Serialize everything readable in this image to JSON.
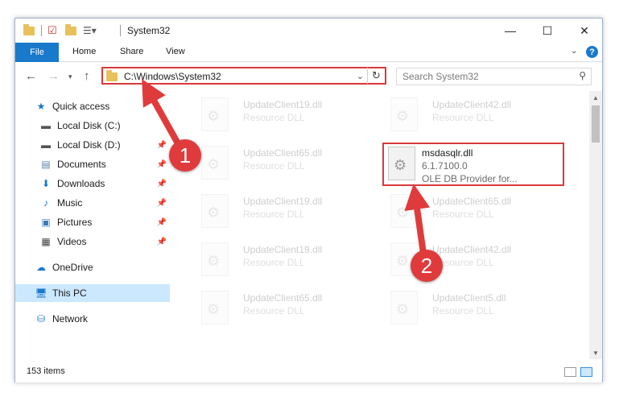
{
  "window": {
    "title": "System32",
    "controls": {
      "minimize": "—",
      "maximize": "☐",
      "close": "✕"
    }
  },
  "ribbon": {
    "file": "File",
    "tabs": [
      "Home",
      "Share",
      "View"
    ],
    "help": "?"
  },
  "address": {
    "path": "C:\\Windows\\System32",
    "search_placeholder": "Search System32"
  },
  "nav_pane": {
    "items": [
      {
        "label": "Quick access",
        "icon": "star-icon"
      },
      {
        "label": "Local Disk (C:)",
        "icon": "drive-icon"
      },
      {
        "label": "Local Disk (D:)",
        "icon": "drive-icon"
      },
      {
        "label": "Documents",
        "icon": "document-icon"
      },
      {
        "label": "Downloads",
        "icon": "download-icon"
      },
      {
        "label": "Music",
        "icon": "music-icon"
      },
      {
        "label": "Pictures",
        "icon": "picture-icon"
      },
      {
        "label": "Videos",
        "icon": "video-icon"
      },
      {
        "label": "OneDrive",
        "icon": "cloud-icon"
      },
      {
        "label": "This PC",
        "icon": "computer-icon"
      },
      {
        "label": "Network",
        "icon": "network-icon"
      }
    ]
  },
  "files": [
    {
      "name": "UpdateClient19.dll",
      "type": "Resource DLL"
    },
    {
      "name": "UpdateClient42.dll",
      "type": "Resource DLL"
    },
    {
      "name": "UpdateClient65.dll",
      "type": "Resource DLL"
    },
    {
      "name": "msdasqlr.dll",
      "version": "6.1.7100.0",
      "description": "OLE DB Provider for..."
    },
    {
      "name": "UpdateClient19.dll",
      "type": "Resource DLL"
    },
    {
      "name": "UpdateClient65.dll",
      "type": "Resource DLL"
    },
    {
      "name": "UpdateClient19.dll",
      "type": "Resource DLL"
    },
    {
      "name": "UpdateClient42.dll",
      "type": "Resource DLL"
    },
    {
      "name": "UpdateClient65.dll",
      "type": "Resource DLL"
    },
    {
      "name": "UpdateClient5.dll",
      "type": "Resource DLL"
    }
  ],
  "status": {
    "item_count": "153 items"
  },
  "annotations": {
    "step1": "1",
    "step2": "2",
    "color": "#e03b3c"
  }
}
